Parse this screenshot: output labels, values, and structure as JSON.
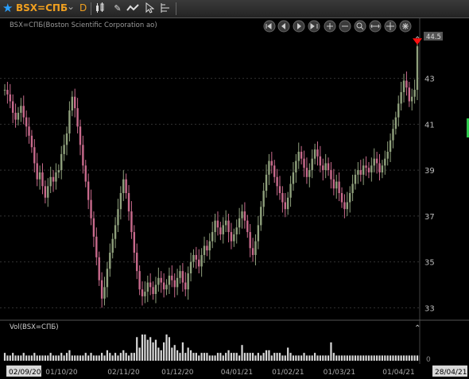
{
  "toolbar": {
    "ric": "BSX=СПБ",
    "period": "D",
    "icons": [
      "star-icon",
      "chevron-down-icon",
      "candlestick-icon",
      "pencil-icon",
      "line-chart-icon",
      "cursor-icon",
      "layout-icon"
    ]
  },
  "chart_data": {
    "type": "candlestick",
    "title": "BSX=СПБ(Boston Scientific Corporation ao)",
    "volume_title": "Vol(BSX=СПБ)",
    "last_price_label": "44.5",
    "ylim": [
      32.7,
      45.1
    ],
    "y_ticks": [
      33,
      35,
      37,
      39,
      41,
      43
    ],
    "volume_tick": "0",
    "x_ticks": [
      {
        "label": "02/09/20",
        "index": 0
      },
      {
        "label": "01/10/20",
        "index": 21
      },
      {
        "label": "02/11/20",
        "index": 44
      },
      {
        "label": "01/12/20",
        "index": 64
      },
      {
        "label": "04/01/21",
        "index": 86
      },
      {
        "label": "01/02/21",
        "index": 105
      },
      {
        "label": "01/03/21",
        "index": 124
      },
      {
        "label": "01/04/21",
        "index": 146
      },
      {
        "label": "28/04/21",
        "index": 165
      }
    ],
    "colors": {
      "up": "#8fa07c",
      "down": "#c86a8c",
      "volume": "#d8d8d8",
      "marker": "#ff1010"
    },
    "closes": [
      42.5,
      42.3,
      42.0,
      41.5,
      41.2,
      41.5,
      41.8,
      41.3,
      40.9,
      40.5,
      40.0,
      39.3,
      38.6,
      38.9,
      38.3,
      37.8,
      38.3,
      38.7,
      38.5,
      38.9,
      39.0,
      39.7,
      40.1,
      40.6,
      41.6,
      42.2,
      41.7,
      40.9,
      40.1,
      39.2,
      38.5,
      37.7,
      36.9,
      36.1,
      35.2,
      34.2,
      33.4,
      33.9,
      34.7,
      35.4,
      36.0,
      36.6,
      37.3,
      38.0,
      38.6,
      38.0,
      37.2,
      36.3,
      35.4,
      34.6,
      33.8,
      33.5,
      33.7,
      34.1,
      33.9,
      33.6,
      34.0,
      34.3,
      34.1,
      33.8,
      34.0,
      34.4,
      34.2,
      33.9,
      34.3,
      34.6,
      34.1,
      33.8,
      34.5,
      35.0,
      35.3,
      35.1,
      34.8,
      35.3,
      35.7,
      35.5,
      35.9,
      36.3,
      36.8,
      36.5,
      36.2,
      36.6,
      36.8,
      36.3,
      35.9,
      36.2,
      36.5,
      36.9,
      37.2,
      36.8,
      36.3,
      35.6,
      35.3,
      35.9,
      36.6,
      37.4,
      38.1,
      38.8,
      39.4,
      39.2,
      38.7,
      38.3,
      38.0,
      37.6,
      37.3,
      37.8,
      38.4,
      38.9,
      39.4,
      39.8,
      39.5,
      39.1,
      38.7,
      39.0,
      39.5,
      39.9,
      39.6,
      39.2,
      39.0,
      39.3,
      39.0,
      38.6,
      38.2,
      38.5,
      38.0,
      37.6,
      37.3,
      37.6,
      38.0,
      38.4,
      38.8,
      39.0,
      38.8,
      39.2,
      39.1,
      38.9,
      39.2,
      39.5,
      39.3,
      38.9,
      39.2,
      39.5,
      39.8,
      40.3,
      40.8,
      41.3,
      41.9,
      42.4,
      42.9,
      42.6,
      42.0,
      42.2,
      42.5,
      44.4
    ],
    "volumes": [
      3,
      2,
      2,
      3,
      2,
      2,
      2,
      3,
      2,
      2,
      2,
      3,
      2,
      2,
      2,
      2,
      2,
      3,
      2,
      2,
      2,
      3,
      2,
      3,
      4,
      2,
      2,
      2,
      2,
      2,
      3,
      2,
      3,
      2,
      2,
      2,
      3,
      2,
      4,
      3,
      2,
      3,
      2,
      3,
      4,
      3,
      2,
      3,
      3,
      9,
      5,
      10,
      10,
      8,
      9,
      7,
      8,
      5,
      4,
      7,
      10,
      9,
      5,
      6,
      4,
      3,
      7,
      3,
      5,
      4,
      3,
      3,
      2,
      3,
      3,
      3,
      2,
      2,
      2,
      3,
      3,
      2,
      3,
      4,
      3,
      3,
      3,
      2,
      6,
      3,
      3,
      3,
      3,
      2,
      3,
      2,
      3,
      4,
      4,
      2,
      3,
      3,
      3,
      2,
      2,
      5,
      3,
      2,
      2,
      2,
      2,
      3,
      2,
      2,
      2,
      3,
      2,
      2,
      2,
      2,
      2,
      7,
      3,
      2,
      2,
      2,
      2,
      2,
      2,
      2,
      2,
      2,
      2,
      2,
      2,
      2,
      2,
      2,
      2,
      2,
      2,
      2,
      2,
      2,
      2,
      2,
      2,
      2,
      2,
      2,
      2,
      2,
      2,
      2,
      2,
      2,
      2,
      2,
      2,
      2,
      2,
      2,
      2,
      2,
      2,
      4
    ]
  }
}
